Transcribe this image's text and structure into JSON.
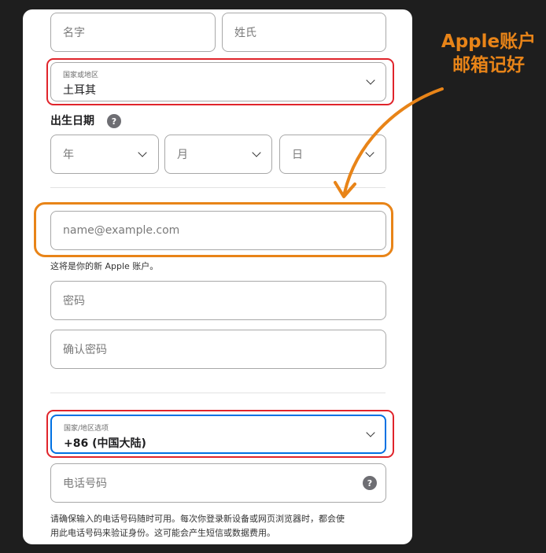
{
  "form": {
    "first_name_placeholder": "名字",
    "last_name_placeholder": "姓氏",
    "country": {
      "label": "国家或地区",
      "value": "土耳其"
    },
    "birthday": {
      "title": "出生日期",
      "help": "?",
      "year_placeholder": "年",
      "month_placeholder": "月",
      "day_placeholder": "日"
    },
    "email": {
      "placeholder": "name@example.com",
      "hint": "这将是你的新 Apple 账户。"
    },
    "password_placeholder": "密码",
    "confirm_password_placeholder": "确认密码",
    "phone_region": {
      "label": "国家/地区选项",
      "value": "+86 (中国大陆)"
    },
    "phone": {
      "placeholder": "电话号码",
      "help": "?"
    },
    "phone_note_line1": "请确保输入的电话号码随时可用。每次你登录新设备或网页浏览器时，都会使",
    "phone_note_line2": "用此电话号码来验证身份。这可能会产生短信或数据费用。"
  },
  "annotation": {
    "line1": "Apple账户",
    "line2": "邮箱记好"
  },
  "colors": {
    "highlight_red": "#e0242b",
    "highlight_orange": "#e88418",
    "focus_blue": "#0071e3",
    "background": "#1e1e1e"
  }
}
